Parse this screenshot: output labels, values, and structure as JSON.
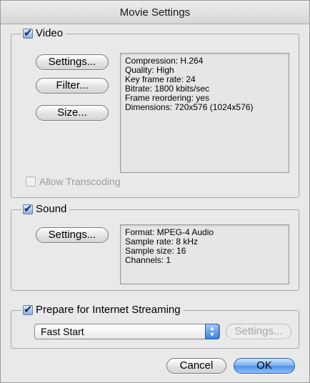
{
  "window": {
    "title": "Movie Settings"
  },
  "video": {
    "label": "Video",
    "checked": true,
    "buttons": {
      "settings": "Settings...",
      "filter": "Filter...",
      "size": "Size..."
    },
    "info": [
      "Compression: H.264",
      "Quality: High",
      "Key frame rate: 24",
      "Bitrate: 1800 kbits/sec",
      "Frame reordering: yes",
      "Dimensions: 720x576 (1024x576)"
    ],
    "allow_transcoding": {
      "label": "Allow Transcoding",
      "checked": false,
      "enabled": false
    }
  },
  "sound": {
    "label": "Sound",
    "checked": true,
    "buttons": {
      "settings": "Settings..."
    },
    "info": [
      "Format: MPEG-4 Audio",
      "Sample rate: 8 kHz",
      "Sample size: 16",
      "Channels: 1"
    ]
  },
  "streaming": {
    "label": "Prepare for Internet Streaming",
    "checked": true,
    "popup": {
      "selected": "Fast Start"
    },
    "settings_label": "Settings...",
    "settings_enabled": false
  },
  "footer": {
    "cancel": "Cancel",
    "ok": "OK"
  }
}
